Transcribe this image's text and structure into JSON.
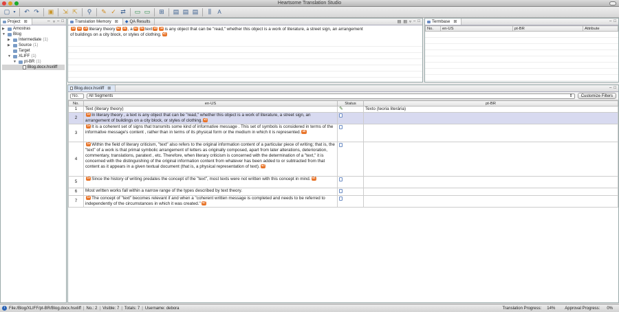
{
  "app": {
    "title": "Heartsome Translation Studio"
  },
  "colors": {
    "tag": "#e8752b",
    "selected_row": "#d8daf0",
    "accent": "#2a63b5"
  },
  "toolbar_icons": [
    "new-icon",
    "dropdown-icon",
    "undo-icon",
    "redo-icon",
    "open-icon",
    "import-icon",
    "export-icon",
    "search-icon",
    "tag-icon",
    "qa-icon",
    "merge-icon",
    "split-icon",
    "preview-icon",
    "translate-icon",
    "document-icon",
    "copy-icon",
    "paste-icon",
    "columns-icon",
    "font-icon"
  ],
  "project": {
    "tab_label": "Project",
    "tree": [
      {
        "label": "Amostras",
        "level": 0,
        "type": "folder",
        "state": "collapsed"
      },
      {
        "label": "Blog",
        "level": 0,
        "type": "folder",
        "state": "expanded"
      },
      {
        "label": "Intermediate",
        "count": "(1)",
        "level": 1,
        "type": "folder",
        "state": "collapsed"
      },
      {
        "label": "Source",
        "count": "(1)",
        "level": 1,
        "type": "folder",
        "state": "collapsed"
      },
      {
        "label": "Target",
        "level": 1,
        "type": "folder",
        "state": "none"
      },
      {
        "label": "XLIFF",
        "count": "(1)",
        "level": 1,
        "type": "folder",
        "state": "expanded"
      },
      {
        "label": "pt-BR",
        "count": "(1)",
        "level": 2,
        "type": "folder",
        "state": "expanded"
      },
      {
        "label": "Blog.docx.hsxliff",
        "level": 3,
        "type": "file",
        "state": "selected"
      }
    ]
  },
  "tm": {
    "tab_translation_memory": "Translation Memory",
    "tab_qa_results": "QA Results",
    "parts_before": "literary theory",
    "parts_mid1": ", a",
    "parts_mid2": "text",
    "parts_after": "is any object that can be \"read,\" whether this object is a work of literature, a street sign, an arrangement",
    "line2": "of buildings on a city block, or styles of clothing."
  },
  "termbase": {
    "tab_label": "Termbase",
    "columns": [
      "No.",
      "en-US",
      "pt-BR",
      "Attribute"
    ]
  },
  "editor": {
    "tab_label": "Blog.docx.hsxliff",
    "filter_no": "No.",
    "filter_value": "All Segments",
    "customize_button": "Customize Filters",
    "columns": {
      "no": "No.",
      "source": "en-US",
      "status": "Status",
      "target": "pt-BR"
    },
    "rows": [
      {
        "no": "1",
        "source": "Text (literary theory)",
        "status": "done",
        "target": "Texto (teoria literária)"
      },
      {
        "no": "2",
        "source": "In literary theory , a text is any object that can be \"read,\" whether this object is a work of literature, a street sign, an arrangement of buildings on a city block, or styles of clothing.",
        "status": "new",
        "target": ""
      },
      {
        "no": "3",
        "source": "It is a coherent set of signs that transmits some kind of informative message . This set of symbols is considered in terms of the informative message's content , rather than in terms of its physical form or the medium in which it is represented.",
        "status": "new",
        "target": ""
      },
      {
        "no": "4",
        "source": "Within the field of literary criticism, \"text\" also refers to the original information content of a particular piece of writing; that is, the \"text\" of a work is that primal symbolic arrangement of letters as originally composed, apart from later alterations, deterioration, commentary, translations, paratext , etc. Therefore, when literary criticism is concerned with the determination of a \"text,\" it is concerned with the distinguishing of the original information content from whatever has been added to or subtracted from that content as it appears in a given textual document (that is, a physical representation of text).",
        "status": "new",
        "target": ""
      },
      {
        "no": "5",
        "source": "Since the history of writing predates the concept of the \"text\", most texts were not written with this concept in mind.",
        "status": "new",
        "target": ""
      },
      {
        "no": "6",
        "source": "Most written works fall within a narrow range of the types described by text theory.",
        "status": "new",
        "target": ""
      },
      {
        "no": "7",
        "source": "The concept of \"text\" becomes relevant if and when a \"coherent written message is completed and needs to be referred to independently of the circumstances in which it was created.\"",
        "status": "new",
        "target": ""
      }
    ]
  },
  "statusbar": {
    "file": "File:/Blog/XLIFF/pt-BR/Blog.docx.hsxliff",
    "no": "No.: 2",
    "visible": "Visible: 7",
    "totals": "Totals: 7",
    "username": "Username: debora",
    "translation_progress_label": "Translation Progress:",
    "translation_progress": "14%",
    "approval_progress_label": "Approval Progress:",
    "approval_progress": "0%"
  }
}
